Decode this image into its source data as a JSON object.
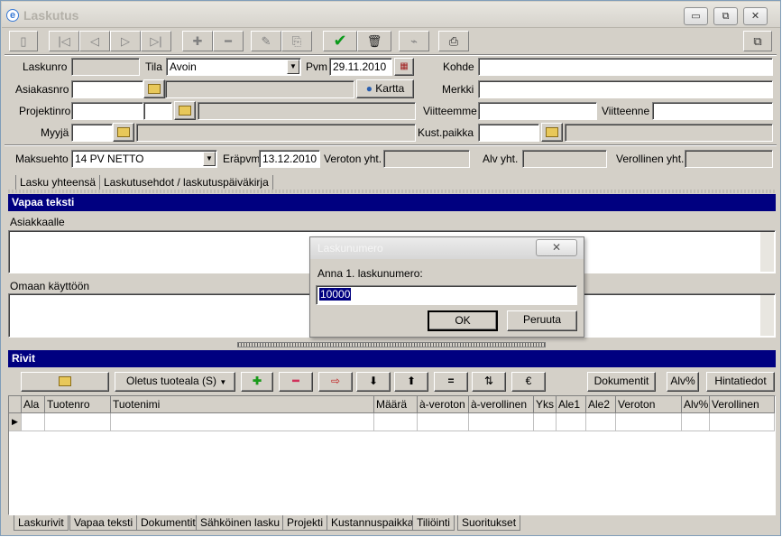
{
  "window": {
    "title": "Laskutus",
    "app_icon": "e"
  },
  "window_buttons": {
    "minimize": "▭",
    "restore": "⧉",
    "close": "✕"
  },
  "toolbar": {
    "buttons": [
      "document-icon",
      "first-icon",
      "prev-icon",
      "next-icon",
      "last-icon",
      "add-icon",
      "remove-icon",
      "edit-icon",
      "copy-icon",
      "accept-icon",
      "delete-icon",
      "link-icon",
      "print-icon"
    ],
    "glyphs": {
      "document": "▯",
      "first": "|◁",
      "prev": "◁",
      "next": "▷",
      "last": "▷|",
      "add": "✚",
      "remove": "━",
      "edit": "✎",
      "copy": "⎘",
      "accept": "✔",
      "delete": "🗑",
      "link": "⌁",
      "print": "⎙",
      "side": "⧉"
    }
  },
  "header": {
    "laskunro_label": "Laskunro",
    "laskunro": "",
    "tila_label": "Tila",
    "tila": "Avoin",
    "pvm_label": "Pvm",
    "pvm": "29.11.2010",
    "kohde_label": "Kohde",
    "kohde": "",
    "asiakasnro_label": "Asiakasnro",
    "asiakasnro": "",
    "kartta_label": "Kartta",
    "merkki_label": "Merkki",
    "merkki": "",
    "projektinro_label": "Projektinro",
    "projektinro": "",
    "viitteemme_label": "Viitteemme",
    "viitteemme": "",
    "viitteenne_label": "Viitteenne",
    "viitteenne": "",
    "myyja_label": "Myyjä",
    "myyja": "",
    "kustpaikka_label": "Kust.paikka",
    "kustpaikka": "",
    "maksuehto_label": "Maksuehto",
    "maksuehto": "14 PV NETTO",
    "erapvm_label": "Eräpvm",
    "erapvm": "13.12.2010",
    "veroton_label": "Veroton yht.",
    "alv_label": "Alv yht.",
    "verollinen_label": "Verollinen yht."
  },
  "upper_tabs": [
    "Lasku yhteensä",
    "Laskutusehdot / laskutuspäiväkirja"
  ],
  "free_text": {
    "title": "Vapaa teksti",
    "customer_label": "Asiakkaalle",
    "internal_label": "Omaan käyttöön"
  },
  "rows": {
    "title": "Rivit",
    "default_area": "Oletus tuoteala (S)",
    "buttons": {
      "plus": "✚",
      "minus": "━",
      "move": "⇨",
      "down": "⬇",
      "up": "⬆",
      "equal": "=",
      "sort": "⇅",
      "euro": "€"
    },
    "dokumentit": "Dokumentit",
    "alv_pct": "Alv%",
    "hintatiedot": "Hintatiedot",
    "columns": [
      "Ala",
      "Tuotenro",
      "Tuotenimi",
      "Määrä",
      "à-veroton",
      "à-verollinen",
      "Yks",
      "Ale1",
      "Ale2",
      "Veroton",
      "Alv%",
      "Verollinen"
    ]
  },
  "bottom_tabs": [
    "Laskurivit",
    "Vapaa teksti",
    "Dokumentit",
    "Sähköinen lasku",
    "Projekti",
    "Kustannuspaikka",
    "Tiliöinti",
    "Suoritukset"
  ],
  "dialog": {
    "title": "Laskunumero",
    "prompt": "Anna 1. laskunumero:",
    "value": "10000",
    "ok": "OK",
    "cancel": "Peruuta",
    "close": "✕"
  }
}
